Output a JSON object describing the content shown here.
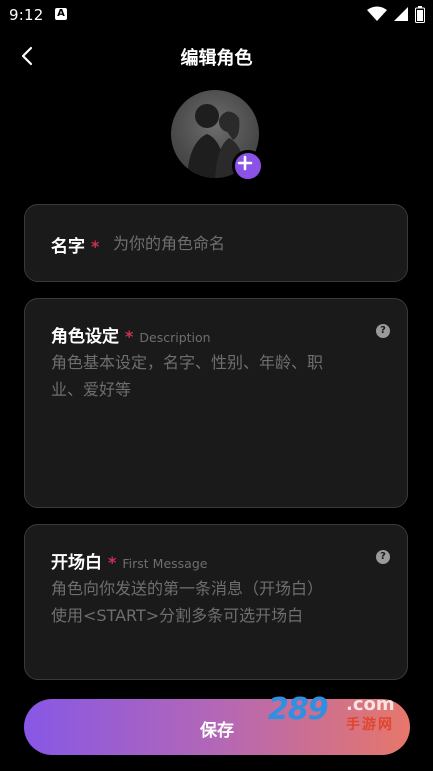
{
  "status_bar": {
    "time": "9:12",
    "app_badge": "A",
    "icons": [
      "wifi-icon",
      "signal-icon",
      "battery-icon"
    ]
  },
  "header": {
    "title": "编辑角色",
    "back_icon": "chevron-left-icon"
  },
  "avatar": {
    "add_icon": "plus-icon",
    "accent_color": "#8b52e8"
  },
  "form": {
    "name": {
      "label": "名字",
      "required_mark": "*",
      "placeholder": "为你的角色命名"
    },
    "description": {
      "label": "角色设定",
      "required_mark": "*",
      "sublabel": "Description",
      "placeholder_line1": "角色基本设定，名字、性别、年龄、职",
      "placeholder_line2": "业、爱好等",
      "help_icon": "question-icon"
    },
    "first_message": {
      "label": "开场白",
      "required_mark": "*",
      "sublabel": "First Message",
      "placeholder_line1": "角色向你发送的第一条消息（开场白）",
      "placeholder_line2": "使用<START>分割多条可选开场白",
      "help_icon": "question-icon"
    }
  },
  "save_button": {
    "label": "保存",
    "gradient": [
      "#8757e6",
      "#e6776a"
    ]
  },
  "watermark": {
    "number": "289",
    "suffix": ".com",
    "text": "手游网"
  }
}
